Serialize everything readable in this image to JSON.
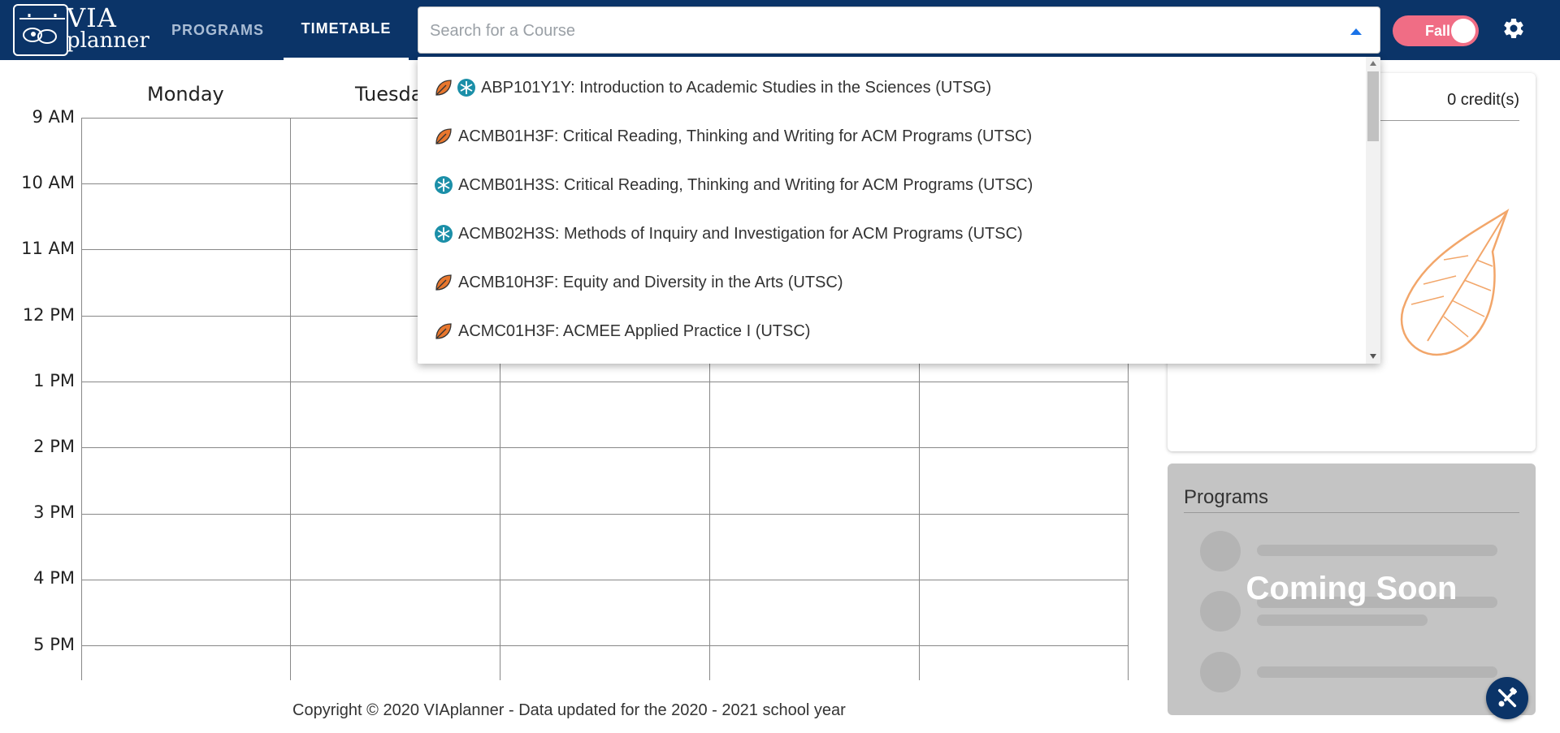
{
  "header": {
    "logo": {
      "line1": "VIA",
      "line2": "planner"
    },
    "tabs": [
      {
        "label": "PROGRAMS",
        "active": false
      },
      {
        "label": "TIMETABLE",
        "active": true
      }
    ],
    "search": {
      "placeholder": "Search for a Course",
      "value": ""
    },
    "term_toggle": {
      "label": "Fall"
    }
  },
  "timetable": {
    "days": [
      "Monday",
      "Tuesday"
    ],
    "times": [
      "9 AM",
      "10 AM",
      "11 AM",
      "12 PM",
      "1 PM",
      "2 PM",
      "3 PM",
      "4 PM",
      "5 PM"
    ]
  },
  "course_panel": {
    "credits": "0 credit(s)"
  },
  "programs_panel": {
    "title": "Programs",
    "overlay": "Coming Soon"
  },
  "dropdown": {
    "items": [
      {
        "label": "ABP101Y1Y: Introduction to Academic Studies in the Sciences (UTSG)",
        "icons": [
          "leaf-icon",
          "snowflake-icon"
        ]
      },
      {
        "label": "ACMB01H3F: Critical Reading, Thinking and Writing for ACM Programs (UTSC)",
        "icons": [
          "leaf-icon"
        ]
      },
      {
        "label": "ACMB01H3S: Critical Reading, Thinking and Writing for ACM Programs (UTSC)",
        "icons": [
          "snowflake-icon"
        ]
      },
      {
        "label": "ACMB02H3S: Methods of Inquiry and Investigation for ACM Programs (UTSC)",
        "icons": [
          "snowflake-icon"
        ]
      },
      {
        "label": "ACMB10H3F: Equity and Diversity in the Arts (UTSC)",
        "icons": [
          "leaf-icon"
        ]
      },
      {
        "label": "ACMC01H3F: ACMEE Applied Practice I (UTSC)",
        "icons": [
          "leaf-icon"
        ]
      }
    ]
  },
  "footer": {
    "text": "Copyright © 2020 VIAplanner - Data updated for the 2020 - 2021 school year"
  },
  "colors": {
    "header_bg": "#0b3468",
    "toggle_fall": "#f06d85",
    "leaf_orange": "#e8772e",
    "snowflake_teal": "#1b8fa8"
  }
}
